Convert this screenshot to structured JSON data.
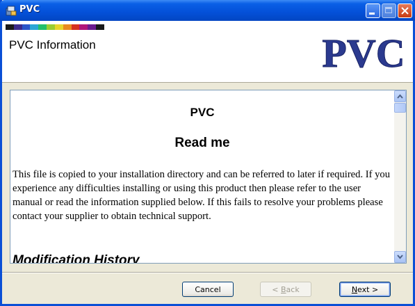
{
  "window": {
    "title": "PVC",
    "buttons": {
      "minimize": "minimize",
      "maximize": "maximize",
      "close": "close"
    }
  },
  "header": {
    "title": "PVC Information",
    "logo_text": "PVC",
    "stripe_colors": [
      "#1a1a1a",
      "#3b2a8c",
      "#2a55c9",
      "#2aa7d6",
      "#21c06b",
      "#9acd32",
      "#e7d52b",
      "#e98a1f",
      "#d63120",
      "#b0157a",
      "#6b1a8f",
      "#1a1a1a"
    ]
  },
  "content": {
    "title": "PVC",
    "subtitle": "Read me",
    "paragraph": "This file is copied to your installation directory and can be referred to later if required. If you experience any difficulties installing or using this product then please refer to the user manual or read the information supplied below. If this fails to resolve your problems please contact your supplier to obtain technical support.",
    "section_heading": "Modification History"
  },
  "footer": {
    "cancel": "Cancel",
    "back_prefix": "< ",
    "back_accel": "B",
    "back_rest": "ack",
    "next_accel": "N",
    "next_rest": "ext >"
  },
  "colors": {
    "titlebar": "#0450d8",
    "logo": "#2b3a8f",
    "face": "#ece9d8"
  }
}
